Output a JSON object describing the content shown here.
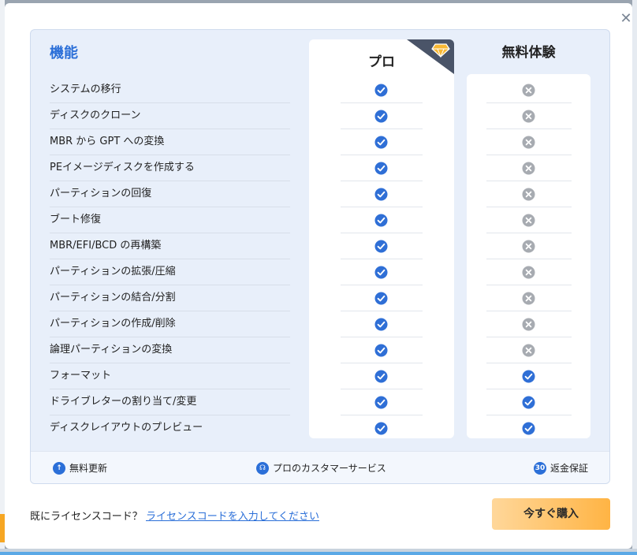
{
  "dialog": {
    "close_label": "✕",
    "features_heading": "機能",
    "pro_heading": "プロ",
    "free_heading": "無料体験",
    "features": [
      {
        "label": "システムの移行",
        "pro": true,
        "free": false
      },
      {
        "label": "ディスクのクローン",
        "pro": true,
        "free": false
      },
      {
        "label": "MBR から GPT への変換",
        "pro": true,
        "free": false
      },
      {
        "label": "PEイメージディスクを作成する",
        "pro": true,
        "free": false
      },
      {
        "label": "パーティションの回復",
        "pro": true,
        "free": false
      },
      {
        "label": "ブート修復",
        "pro": true,
        "free": false
      },
      {
        "label": "MBR/EFI/BCD の再構築",
        "pro": true,
        "free": false
      },
      {
        "label": "パーティションの拡張/圧縮",
        "pro": true,
        "free": false
      },
      {
        "label": "パーティションの結合/分割",
        "pro": true,
        "free": false
      },
      {
        "label": "パーティションの作成/削除",
        "pro": true,
        "free": false
      },
      {
        "label": "論理パーティションの変換",
        "pro": true,
        "free": false
      },
      {
        "label": "フォーマット",
        "pro": true,
        "free": true
      },
      {
        "label": "ドライブレターの割り当て/変更",
        "pro": true,
        "free": true
      },
      {
        "label": "ディスクレイアウトのプレビュー",
        "pro": true,
        "free": true
      }
    ],
    "benefits": {
      "updates": "無料更新",
      "support": "プロのカスタマーサービス",
      "refund": "返金保証",
      "refund_badge": "30"
    },
    "license_question": "既にライセンスコード？",
    "license_link": "ライセンスコードを入力してください",
    "buy_label": "今すぐ購入"
  },
  "colors": {
    "accent": "#2b6fd8",
    "check": "#2f6fd6",
    "cross": "#a7abb1",
    "buy_start": "#ffd79a",
    "buy_end": "#ffb444"
  }
}
